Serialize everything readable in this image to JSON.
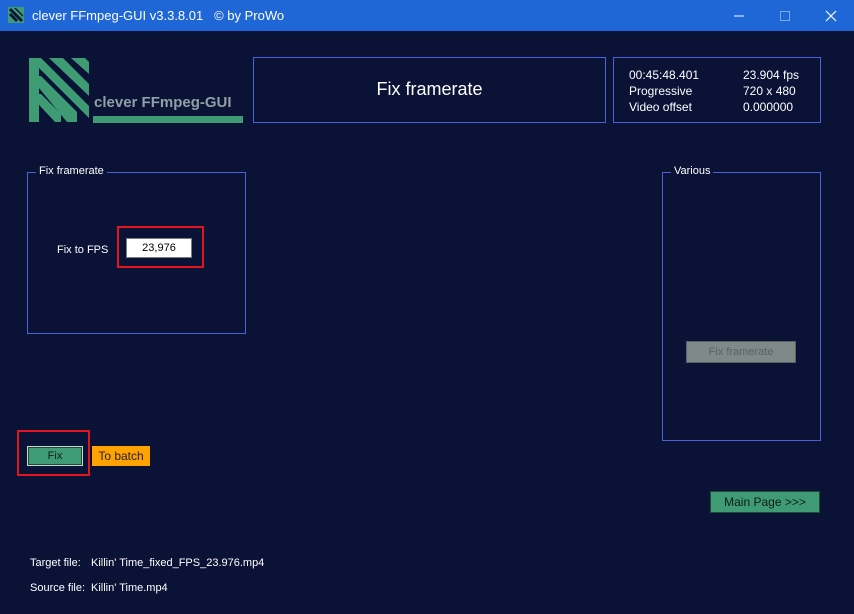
{
  "window": {
    "title": "clever FFmpeg-GUI v3.3.8.01   © by ProWo"
  },
  "logo": {
    "text": "clever FFmpeg-GUI",
    "color": "#3f9b73"
  },
  "header": {
    "title": "Fix framerate"
  },
  "info": {
    "duration": "00:45:48.401",
    "fps": "23.904 fps",
    "scan": "Progressive",
    "resolution": "720 x 480",
    "offset_label": "Video offset",
    "offset_value": "0.000000"
  },
  "fix_group": {
    "legend": "Fix framerate",
    "fps_label": "Fix to FPS",
    "fps_value": "23,976"
  },
  "various_group": {
    "legend": "Various",
    "button_label": "Fix framerate"
  },
  "actions": {
    "fix_label": "Fix",
    "batch_label": "To batch",
    "main_page_label": "Main Page >>>"
  },
  "files": {
    "target_label": "Target file:",
    "target_value": "Killin' Time_fixed_FPS_23.976.mp4",
    "source_label": "Source file:",
    "source_value": "Killin' Time.mp4"
  },
  "colors": {
    "background": "#0a1235",
    "titlebar": "#1f66d6",
    "panel_border": "#4a62d8",
    "highlight": "#e3141d",
    "accent_green": "#3f9b73",
    "accent_orange": "#ffa300"
  }
}
